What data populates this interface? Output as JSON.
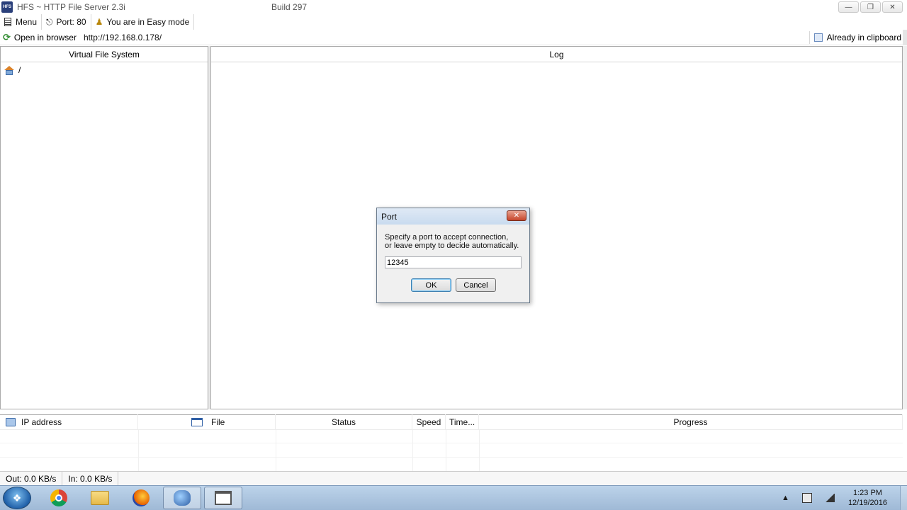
{
  "window": {
    "title": "HFS ~ HTTP File Server 2.3i",
    "build": "Build 297",
    "icon_text": "HFS"
  },
  "toolbar": {
    "menu_label": "Menu",
    "port_label": "Port: 80",
    "mode_label": "You are in Easy mode"
  },
  "address_bar": {
    "open_in_browser": "Open in browser",
    "url": "http://192.168.0.178/",
    "clipboard_status": "Already in clipboard"
  },
  "vfs": {
    "header": "Virtual File System",
    "root_label": "/"
  },
  "log": {
    "header": "Log"
  },
  "connections": {
    "columns": [
      "IP address",
      "File",
      "Status",
      "Speed",
      "Time...",
      "Progress"
    ]
  },
  "statusbar": {
    "out": "Out: 0.0 KB/s",
    "in": "In: 0.0 KB/s"
  },
  "dialog": {
    "title": "Port",
    "message_line1": "Specify a port to accept connection,",
    "message_line2": "or leave empty to decide automatically.",
    "input_value": "12345",
    "ok_label": "OK",
    "cancel_label": "Cancel",
    "close_glyph": "✕"
  },
  "taskbar": {
    "clock_time": "1:23 PM",
    "clock_date": "12/19/2016",
    "apps": [
      "chrome-icon",
      "folder-icon",
      "firefox-icon",
      "hfs-icon",
      "window-icon"
    ]
  },
  "colors": {
    "dialog_close": "#c6462c",
    "taskbar": "#a9c2de"
  }
}
